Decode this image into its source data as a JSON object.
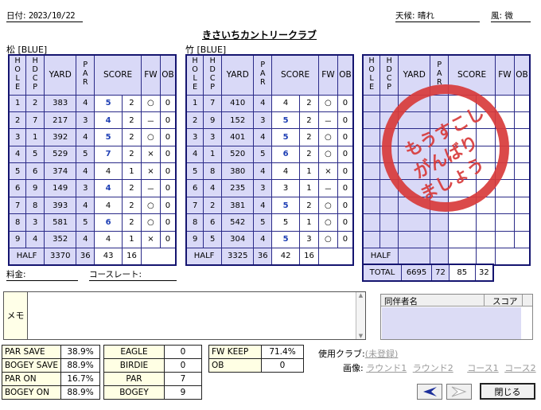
{
  "header": {
    "date_label": "日付:",
    "date_value": "2023/10/22",
    "weather_label": "天候:",
    "weather_value": "晴れ",
    "wind_label": "風:",
    "wind_value": "微",
    "course_name": "きさいちカントリークラブ"
  },
  "columns": [
    "HOLE",
    "HDCP",
    "YARD",
    "PAR",
    "SCORE",
    "FW",
    "OB"
  ],
  "front": {
    "title": "松 [BLUE]",
    "rows": [
      {
        "hole": "1",
        "hdcp": "2",
        "yard": "383",
        "par": "4",
        "score": "5",
        "putt": "2",
        "fw": "○",
        "ob": "0"
      },
      {
        "hole": "2",
        "hdcp": "7",
        "yard": "217",
        "par": "3",
        "score": "4",
        "putt": "2",
        "fw": "－",
        "ob": "0"
      },
      {
        "hole": "3",
        "hdcp": "1",
        "yard": "392",
        "par": "4",
        "score": "5",
        "putt": "2",
        "fw": "○",
        "ob": "0"
      },
      {
        "hole": "4",
        "hdcp": "5",
        "yard": "529",
        "par": "5",
        "score": "7",
        "putt": "2",
        "fw": "×",
        "ob": "0"
      },
      {
        "hole": "5",
        "hdcp": "6",
        "yard": "374",
        "par": "4",
        "score": "4",
        "putt": "1",
        "fw": "×",
        "ob": "0"
      },
      {
        "hole": "6",
        "hdcp": "9",
        "yard": "149",
        "par": "3",
        "score": "4",
        "putt": "2",
        "fw": "－",
        "ob": "0"
      },
      {
        "hole": "7",
        "hdcp": "8",
        "yard": "393",
        "par": "4",
        "score": "4",
        "putt": "2",
        "fw": "○",
        "ob": "0"
      },
      {
        "hole": "8",
        "hdcp": "3",
        "yard": "581",
        "par": "5",
        "score": "6",
        "putt": "2",
        "fw": "○",
        "ob": "0"
      },
      {
        "hole": "9",
        "hdcp": "4",
        "yard": "352",
        "par": "4",
        "score": "4",
        "putt": "1",
        "fw": "×",
        "ob": "0"
      }
    ],
    "half_label": "HALF",
    "half_yard": "3370",
    "half_par": "36",
    "half_score": "43",
    "half_putt": "16"
  },
  "back": {
    "title": "竹 [BLUE]",
    "rows": [
      {
        "hole": "1",
        "hdcp": "7",
        "yard": "410",
        "par": "4",
        "score": "4",
        "putt": "2",
        "fw": "○",
        "ob": "0"
      },
      {
        "hole": "2",
        "hdcp": "9",
        "yard": "152",
        "par": "3",
        "score": "5",
        "putt": "2",
        "fw": "－",
        "ob": "0"
      },
      {
        "hole": "3",
        "hdcp": "3",
        "yard": "401",
        "par": "4",
        "score": "5",
        "putt": "2",
        "fw": "○",
        "ob": "0"
      },
      {
        "hole": "4",
        "hdcp": "1",
        "yard": "520",
        "par": "5",
        "score": "6",
        "putt": "2",
        "fw": "○",
        "ob": "0"
      },
      {
        "hole": "5",
        "hdcp": "8",
        "yard": "380",
        "par": "4",
        "score": "4",
        "putt": "1",
        "fw": "×",
        "ob": "0"
      },
      {
        "hole": "6",
        "hdcp": "4",
        "yard": "235",
        "par": "3",
        "score": "3",
        "putt": "1",
        "fw": "－",
        "ob": "0"
      },
      {
        "hole": "7",
        "hdcp": "2",
        "yard": "381",
        "par": "4",
        "score": "5",
        "putt": "2",
        "fw": "○",
        "ob": "0"
      },
      {
        "hole": "8",
        "hdcp": "6",
        "yard": "542",
        "par": "5",
        "score": "5",
        "putt": "1",
        "fw": "○",
        "ob": "0"
      },
      {
        "hole": "9",
        "hdcp": "5",
        "yard": "304",
        "par": "4",
        "score": "5",
        "putt": "3",
        "fw": "○",
        "ob": "0"
      }
    ],
    "half_label": "HALF",
    "half_yard": "3325",
    "half_par": "36",
    "half_score": "42",
    "half_putt": "16"
  },
  "extra": {
    "half_label": "HALF",
    "total_label": "TOTAL",
    "total_yard": "6695",
    "total_par": "72",
    "total_score": "85",
    "total_putt": "32"
  },
  "stamp": {
    "lines": [
      "もうすこし",
      "がんばり",
      "ましょう"
    ],
    "color": "#d83b3b"
  },
  "fee_label": "料金:",
  "rate_label": "コースレート:",
  "memo": {
    "label": "メモ",
    "text": ""
  },
  "companions": {
    "name_header": "同伴者名",
    "score_header": "スコア"
  },
  "stats_left": [
    {
      "label": "PAR SAVE",
      "value": "38.9%"
    },
    {
      "label": "BOGEY SAVE",
      "value": "88.9%"
    },
    {
      "label": "PAR ON",
      "value": "16.7%"
    },
    {
      "label": "BOGEY ON",
      "value": "88.9%"
    }
  ],
  "stats_mid": [
    {
      "label": "EAGLE",
      "value": "0"
    },
    {
      "label": "BIRDIE",
      "value": "0"
    },
    {
      "label": "PAR",
      "value": "7"
    },
    {
      "label": "BOGEY",
      "value": "9"
    }
  ],
  "stats_right": [
    {
      "label": "FW KEEP",
      "value": "71.4%"
    },
    {
      "label": "OB",
      "value": "0"
    }
  ],
  "clubs": {
    "label": "使用クラブ:",
    "value": "(未登録)"
  },
  "images": {
    "label": "画像:",
    "links": [
      "ラウンド1",
      "ラウンド2",
      "コース1",
      "コース2"
    ]
  },
  "buttons": {
    "close": "閉じる"
  },
  "colors": {
    "grid_border": "#151570",
    "cell_fill": "#d9d9f7",
    "score_blue": "#1e3fb4",
    "stat_fill": "#ffffe4"
  }
}
